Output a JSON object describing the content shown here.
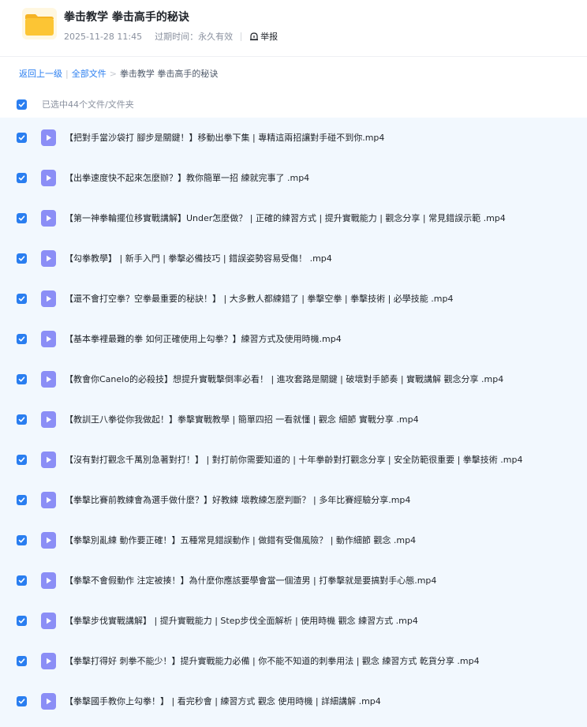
{
  "header": {
    "title": "拳击教学 拳击高手的秘诀",
    "date": "2025-11-28 11:45",
    "expire_label": "过期时间：永久有效",
    "report_label": "举报",
    "folder_icon": "folder-icon",
    "report_icon": "report-icon"
  },
  "breadcrumb": {
    "back": "返回上一级",
    "all_files": "全部文件",
    "arrow": ">",
    "current": "拳击教学 拳击高手的秘诀"
  },
  "selection": {
    "label": "已选中44个文件/文件夹",
    "checked": true
  },
  "colors": {
    "accent": "#2a7ef0",
    "video_icon": "#8b8ef6",
    "list_bg": "#f2f8fe"
  },
  "files": [
    {
      "name": "【把對手當沙袋打 腳步是關鍵！】移動出拳下集 | 專精這兩招讓對手碰不到你.mp4",
      "checked": true
    },
    {
      "name": "【出拳速度快不起來怎麼辦？】教你簡單一招 練就完事了 .mp4",
      "checked": true
    },
    {
      "name": "【第一神拳輪擺位移實戰講解】Under怎麼做？ | 正確的練習方式 | 提升實戰能力 | 觀念分享 | 常見錯誤示範 .mp4",
      "checked": true
    },
    {
      "name": "【勾拳教學】 | 新手入門 | 拳擊必備技巧 | 錯誤姿勢容易受傷！ .mp4",
      "checked": true
    },
    {
      "name": "【還不會打空拳？空拳最重要的秘訣！】 | 大多數人都練錯了 | 拳擊空拳 | 拳擊技術 | 必學技能 .mp4",
      "checked": true
    },
    {
      "name": "【基本拳裡最難的拳 如何正確使用上勾拳？】練習方式及使用時機.mp4",
      "checked": true
    },
    {
      "name": "【教會你Canelo的必殺技】想提升實戰擊倒率必看！ | 進攻套路是關鍵 | 破壞對手節奏 | 實戰講解 觀念分享 .mp4",
      "checked": true
    },
    {
      "name": "【教訓王八拳從你我做起！】拳擊實戰教學 | 簡單四招 一看就懂 | 觀念 細節 實戰分享 .mp4",
      "checked": true
    },
    {
      "name": "【沒有對打觀念千萬別急著對打！】 | 對打前你需要知道的 | 十年拳齡對打觀念分享 | 安全防範很重要 | 拳擊技術 .mp4",
      "checked": true
    },
    {
      "name": "【拳擊比賽前教練會為選手做什麼？】好教練 壞教練怎麼判斷？ | 多年比賽經驗分享.mp4",
      "checked": true
    },
    {
      "name": "【拳擊別亂練 動作要正確！】五種常見錯誤動作 | 做錯有受傷風險？ | 動作細節 觀念 .mp4",
      "checked": true
    },
    {
      "name": "【拳擊不會假動作 注定被揍！】為什麼你應該要學會當一個渣男 | 打拳擊就是要搞對手心態.mp4",
      "checked": true
    },
    {
      "name": "【拳擊步伐實戰講解】 | 提升實戰能力 | Step步伐全面解析 | 使用時機 觀念 練習方式 .mp4",
      "checked": true
    },
    {
      "name": "【拳擊打得好 刺拳不能少！】提升實戰能力必備 | 你不能不知道的刺拳用法 | 觀念 練習方式 乾貨分享 .mp4",
      "checked": true
    },
    {
      "name": "【拳擊國手教你上勾拳！】 | 看完秒會 | 練習方式 觀念 使用時機 | 詳細講解 .mp4",
      "checked": true
    }
  ]
}
